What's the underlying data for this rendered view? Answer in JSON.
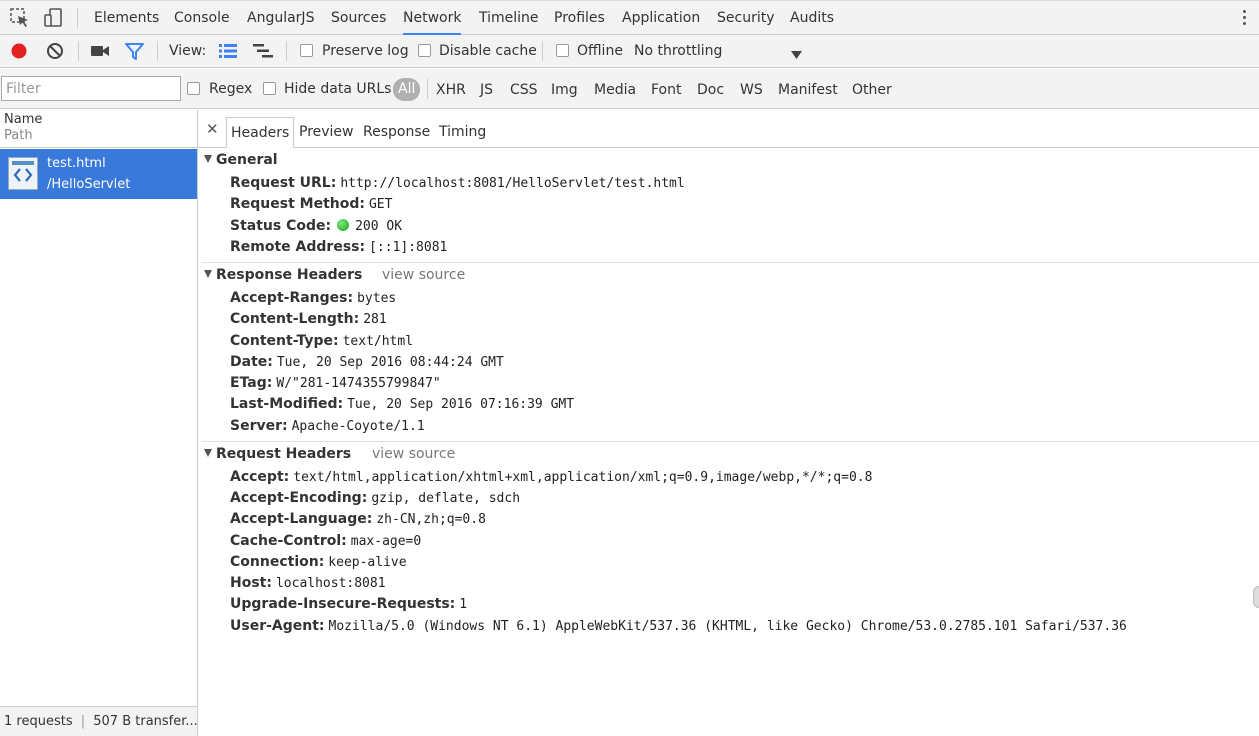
{
  "panel_tabs": [
    "Elements",
    "Console",
    "AngularJS",
    "Sources",
    "Network",
    "Timeline",
    "Profiles",
    "Application",
    "Security",
    "Audits"
  ],
  "active_panel_tab": "Network",
  "toolbar": {
    "view_label": "View:",
    "preserve_log": "Preserve log",
    "disable_cache": "Disable cache",
    "offline": "Offline",
    "throttling": "No throttling",
    "record_color": "#e52020",
    "filter_color": "#3e82f7"
  },
  "filterbar": {
    "filter_placeholder": "Filter",
    "regex": "Regex",
    "hide_data_urls": "Hide data URLs",
    "types": [
      "All",
      "XHR",
      "JS",
      "CSS",
      "Img",
      "Media",
      "Font",
      "Doc",
      "WS",
      "Manifest",
      "Other"
    ],
    "active_type": "All"
  },
  "request_list": {
    "col_name": "Name",
    "col_path": "Path",
    "rows": [
      {
        "name": "test.html",
        "path": "/HelloServlet",
        "icon": "html-file-icon",
        "selected": true
      }
    ],
    "footer_count": "1 requests",
    "footer_transfer": "507 B transfer..."
  },
  "detail_tabs": [
    "Headers",
    "Preview",
    "Response",
    "Timing"
  ],
  "active_detail_tab": "Headers",
  "general": {
    "title": "General",
    "rows": [
      {
        "key": "Request URL:",
        "value": "http://localhost:8081/HelloServlet/test.html"
      },
      {
        "key": "Request Method:",
        "value": "GET"
      },
      {
        "key": "Status Code:",
        "value": "200 OK",
        "status_color": "#22aa22"
      },
      {
        "key": "Remote Address:",
        "value": "[::1]:8081"
      }
    ]
  },
  "response_headers": {
    "title": "Response Headers",
    "view_source": "view source",
    "rows": [
      {
        "key": "Accept-Ranges:",
        "value": "bytes"
      },
      {
        "key": "Content-Length:",
        "value": "281"
      },
      {
        "key": "Content-Type:",
        "value": "text/html"
      },
      {
        "key": "Date:",
        "value": "Tue, 20 Sep 2016 08:44:24 GMT"
      },
      {
        "key": "ETag:",
        "value": "W/\"281-1474355799847\""
      },
      {
        "key": "Last-Modified:",
        "value": "Tue, 20 Sep 2016 07:16:39 GMT"
      },
      {
        "key": "Server:",
        "value": "Apache-Coyote/1.1"
      }
    ]
  },
  "request_headers": {
    "title": "Request Headers",
    "view_source": "view source",
    "rows": [
      {
        "key": "Accept:",
        "value": "text/html,application/xhtml+xml,application/xml;q=0.9,image/webp,*/*;q=0.8"
      },
      {
        "key": "Accept-Encoding:",
        "value": "gzip, deflate, sdch"
      },
      {
        "key": "Accept-Language:",
        "value": "zh-CN,zh;q=0.8"
      },
      {
        "key": "Cache-Control:",
        "value": "max-age=0"
      },
      {
        "key": "Connection:",
        "value": "keep-alive"
      },
      {
        "key": "Host:",
        "value": "localhost:8081"
      },
      {
        "key": "Upgrade-Insecure-Requests:",
        "value": "1"
      },
      {
        "key": "User-Agent:",
        "value": "Mozilla/5.0 (Windows NT 6.1) AppleWebKit/537.36 (KHTML, like Gecko) Chrome/53.0.2785.101 Safari/537.36"
      }
    ]
  }
}
